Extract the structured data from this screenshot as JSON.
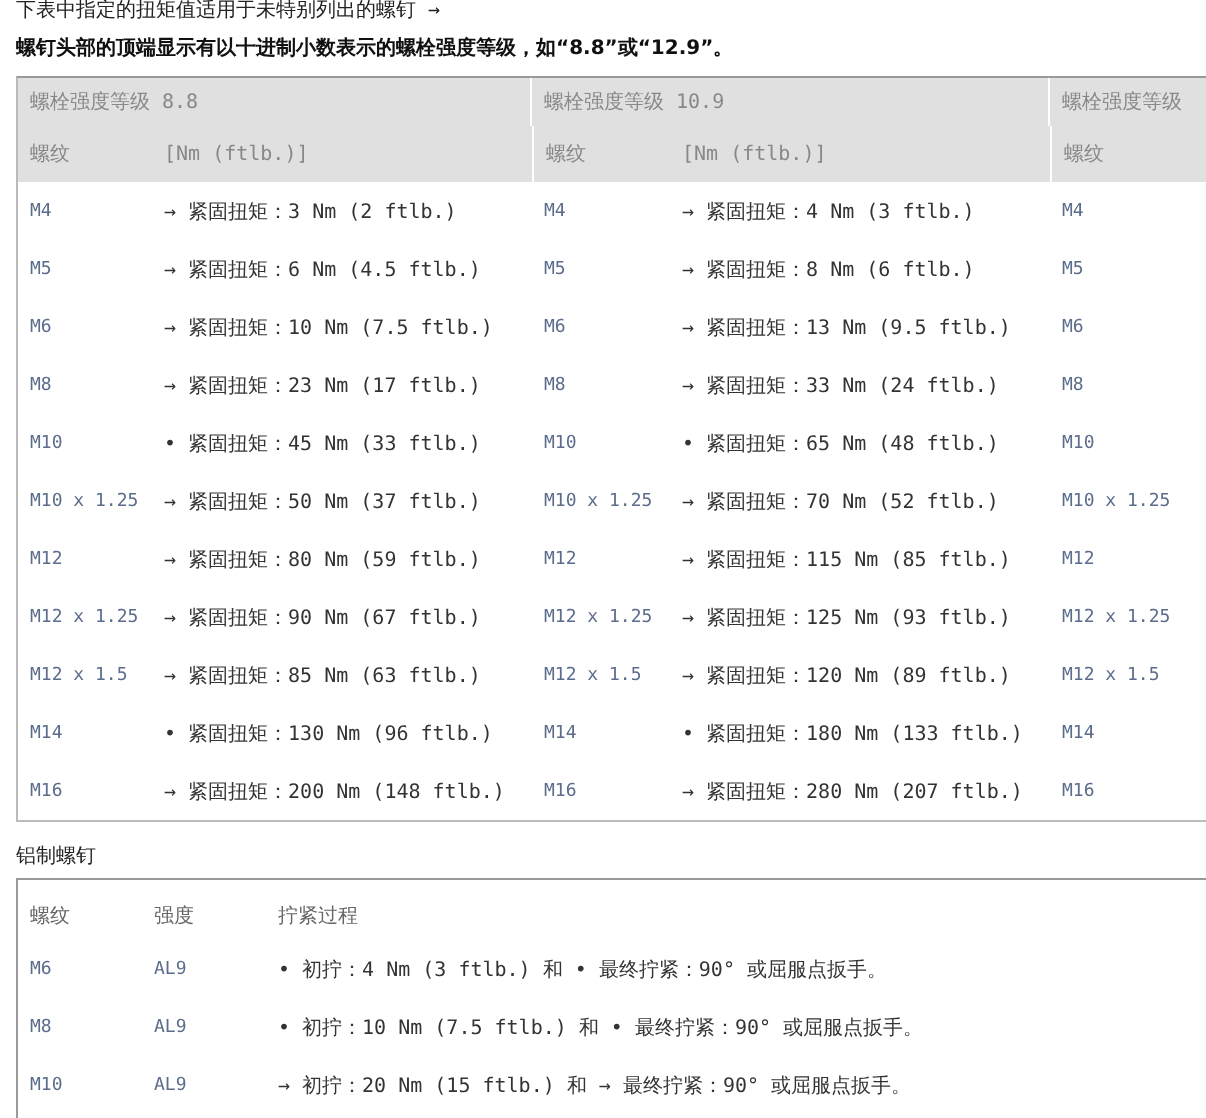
{
  "intro": "下表中指定的扭矩值适用于未特别列出的螺钉 →",
  "heading": "螺钉头部的顶端显示有以十进制小数表示的螺栓强度等级，如“8.8”或“12.9”。",
  "strength_table": {
    "groups": [
      {
        "title": "螺栓强度等级 8.8",
        "columns": [
          "螺纹",
          "[Nm (ftlb.)]"
        ]
      },
      {
        "title": "螺栓强度等级 10.9",
        "columns": [
          "螺纹",
          "[Nm (ftlb.)]"
        ]
      },
      {
        "title": "螺栓强度等级",
        "columns": [
          "螺纹"
        ]
      }
    ],
    "rows": [
      {
        "cells": [
          {
            "thread": "M4",
            "marker": "→",
            "torque": "紧固扭矩：3 Nm (2 ftlb.)"
          },
          {
            "thread": "M4",
            "marker": "→",
            "torque": "紧固扭矩：4 Nm (3 ftlb.)"
          },
          {
            "thread": "M4"
          }
        ]
      },
      {
        "cells": [
          {
            "thread": "M5",
            "marker": "→",
            "torque": "紧固扭矩：6 Nm (4.5 ftlb.)"
          },
          {
            "thread": "M5",
            "marker": "→",
            "torque": "紧固扭矩：8 Nm (6 ftlb.)"
          },
          {
            "thread": "M5"
          }
        ]
      },
      {
        "cells": [
          {
            "thread": "M6",
            "marker": "→",
            "torque": "紧固扭矩：10 Nm (7.5 ftlb.)"
          },
          {
            "thread": "M6",
            "marker": "→",
            "torque": "紧固扭矩：13 Nm (9.5 ftlb.)"
          },
          {
            "thread": "M6"
          }
        ]
      },
      {
        "cells": [
          {
            "thread": "M8",
            "marker": "→",
            "torque": "紧固扭矩：23 Nm (17 ftlb.)"
          },
          {
            "thread": "M8",
            "marker": "→",
            "torque": "紧固扭矩：33 Nm (24 ftlb.)"
          },
          {
            "thread": "M8"
          }
        ]
      },
      {
        "cells": [
          {
            "thread": "M10",
            "marker": "•",
            "torque": "紧固扭矩：45 Nm (33 ftlb.)"
          },
          {
            "thread": "M10",
            "marker": "•",
            "torque": "紧固扭矩：65 Nm (48 ftlb.)"
          },
          {
            "thread": "M10"
          }
        ]
      },
      {
        "cells": [
          {
            "thread": "M10 x 1.25",
            "marker": "→",
            "torque": "紧固扭矩：50 Nm (37 ftlb.)"
          },
          {
            "thread": "M10 x 1.25",
            "marker": "→",
            "torque": "紧固扭矩：70 Nm (52 ftlb.)"
          },
          {
            "thread": "M10 x 1.25"
          }
        ]
      },
      {
        "cells": [
          {
            "thread": "M12",
            "marker": "→",
            "torque": "紧固扭矩：80 Nm (59 ftlb.)"
          },
          {
            "thread": "M12",
            "marker": "→",
            "torque": "紧固扭矩：115 Nm (85 ftlb.)"
          },
          {
            "thread": "M12"
          }
        ]
      },
      {
        "cells": [
          {
            "thread": "M12 x 1.25",
            "marker": "→",
            "torque": "紧固扭矩：90 Nm (67 ftlb.)"
          },
          {
            "thread": "M12 x 1.25",
            "marker": "→",
            "torque": "紧固扭矩：125 Nm (93 ftlb.)"
          },
          {
            "thread": "M12 x 1.25"
          }
        ]
      },
      {
        "cells": [
          {
            "thread": "M12 x 1.5",
            "marker": "→",
            "torque": "紧固扭矩：85 Nm (63 ftlb.)"
          },
          {
            "thread": "M12 x 1.5",
            "marker": "→",
            "torque": "紧固扭矩：120 Nm (89 ftlb.)"
          },
          {
            "thread": "M12 x 1.5"
          }
        ]
      },
      {
        "cells": [
          {
            "thread": "M14",
            "marker": "•",
            "torque": "紧固扭矩：130 Nm (96 ftlb.)"
          },
          {
            "thread": "M14",
            "marker": "•",
            "torque": "紧固扭矩：180 Nm (133 ftlb.)"
          },
          {
            "thread": "M14"
          }
        ]
      },
      {
        "cells": [
          {
            "thread": "M16",
            "marker": "→",
            "torque": "紧固扭矩：200 Nm (148 ftlb.)"
          },
          {
            "thread": "M16",
            "marker": "→",
            "torque": "紧固扭矩：280 Nm (207 ftlb.)"
          },
          {
            "thread": "M16"
          }
        ]
      }
    ]
  },
  "aluminum_heading": "铝制螺钉",
  "aluminum_table": {
    "columns": [
      "螺纹",
      "强度",
      "拧紧过程"
    ],
    "rows": [
      {
        "thread": "M6",
        "strength": "AL9",
        "procedure": "• 初拧：4 Nm (3 ftlb.) 和 • 最终拧紧：90° 或屈服点扳手。"
      },
      {
        "thread": "M8",
        "strength": "AL9",
        "procedure": "• 初拧：10 Nm (7.5 ftlb.) 和 • 最终拧紧：90° 或屈服点扳手。"
      },
      {
        "thread": "M10",
        "strength": "AL9",
        "procedure": "→ 初拧：20 Nm (15 ftlb.) 和 → 最终拧紧：90° 或屈服点扳手。"
      }
    ]
  }
}
